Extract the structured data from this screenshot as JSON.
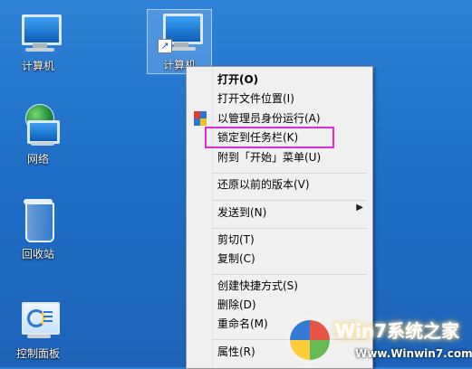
{
  "desktop": {
    "icons": [
      {
        "label": "计算机",
        "icon": "computer-icon"
      },
      {
        "label": "网络",
        "icon": "network-icon"
      },
      {
        "label": "回收站",
        "icon": "recycle-bin-icon"
      },
      {
        "label": "控制面板",
        "icon": "control-panel-icon"
      }
    ],
    "selected_shortcut": {
      "label": "计算机",
      "icon": "computer-shortcut-icon"
    }
  },
  "context_menu": {
    "items": [
      {
        "label": "打开(O)",
        "bold": true
      },
      {
        "label": "打开文件位置(I)"
      },
      {
        "label": "以管理员身份运行(A)",
        "icon": "uac-shield-icon"
      },
      {
        "label": "锁定到任务栏(K)",
        "highlighted": true,
        "highlight_color": "#e22bd4"
      },
      {
        "label": "附到「开始」菜单(U)"
      },
      {
        "label": "还原以前的版本(V)"
      },
      {
        "label": "发送到(N)",
        "has_submenu": true
      },
      {
        "label": "剪切(T)"
      },
      {
        "label": "复制(C)"
      },
      {
        "label": "创建快捷方式(S)"
      },
      {
        "label": "删除(D)"
      },
      {
        "label": "重命名(M)"
      },
      {
        "label": "属性(R)"
      }
    ]
  },
  "watermark": {
    "title": "Win7系统之家",
    "url": "Www.Winwin7.com"
  },
  "colors": {
    "desktop_top": "#2f82d6",
    "desktop_bottom": "#1d63b8",
    "menu_bg": "#f0f0f0",
    "highlight_outline": "#e22bd4"
  }
}
